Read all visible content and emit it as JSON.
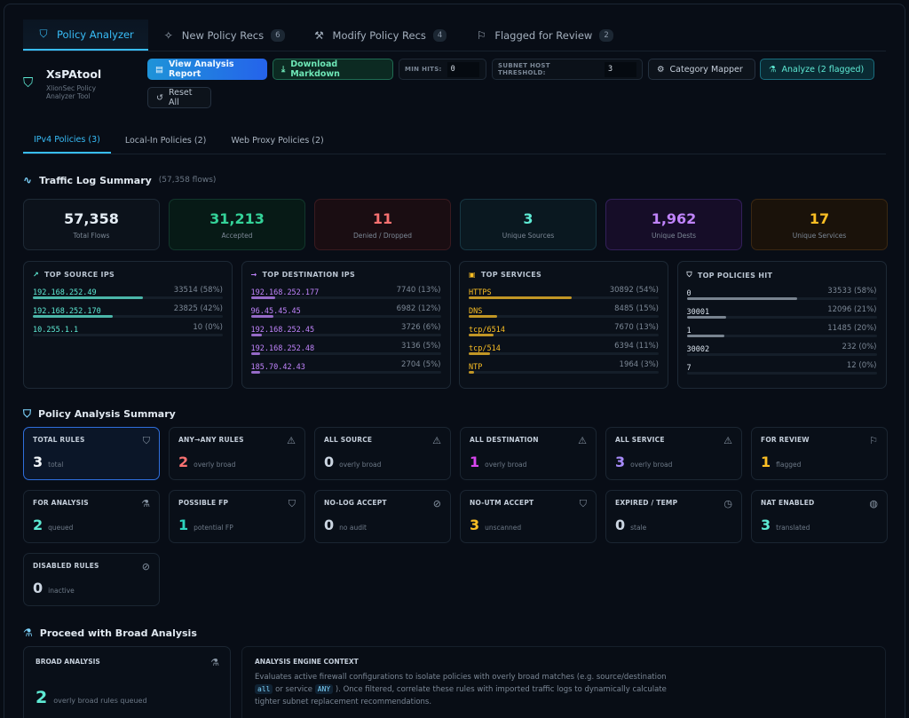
{
  "tabs": [
    {
      "label": "Policy Analyzer",
      "badge": ""
    },
    {
      "label": "New Policy Recs",
      "badge": "6"
    },
    {
      "label": "Modify Policy Recs",
      "badge": "4"
    },
    {
      "label": "Flagged for Review",
      "badge": "2"
    }
  ],
  "brand": {
    "title": "XsPAtool",
    "subtitle": "XlionSec Policy Analyzer Tool"
  },
  "toolbar": {
    "view_report": "View Analysis Report",
    "download_md": "Download Markdown",
    "min_hits_label": "MIN HITS:",
    "min_hits_value": "0",
    "subnet_label": "SUBNET HOST THRESHOLD:",
    "subnet_value": "3",
    "category_mapper": "Category Mapper",
    "analyze": "Analyze (2 flagged)",
    "reset": "Reset All"
  },
  "subtabs": [
    "IPv4 Policies (3)",
    "Local-In Policies (2)",
    "Web Proxy Policies (2)"
  ],
  "traffic": {
    "title": "Traffic Log Summary",
    "note": "(57,358 flows)",
    "metrics": [
      {
        "value": "57,358",
        "label": "Total Flows",
        "color": "#e5edf5"
      },
      {
        "value": "31,213",
        "label": "Accepted",
        "color": "#34d399"
      },
      {
        "value": "11",
        "label": "Denied / Dropped",
        "color": "#f87171"
      },
      {
        "value": "3",
        "label": "Unique Sources",
        "color": "#5eead4"
      },
      {
        "value": "1,962",
        "label": "Unique Dests",
        "color": "#c084fc"
      },
      {
        "value": "17",
        "label": "Unique Services",
        "color": "#fbbf24"
      }
    ]
  },
  "lists": [
    {
      "title": "TOP SOURCE IPS",
      "color": "#5eead4",
      "rows": [
        {
          "key": "192.168.252.49",
          "count": "33514 (58%)",
          "pct": 58
        },
        {
          "key": "192.168.252.170",
          "count": "23825 (42%)",
          "pct": 42
        },
        {
          "key": "10.255.1.1",
          "count": "10 (0%)",
          "pct": 0
        }
      ]
    },
    {
      "title": "TOP DESTINATION IPS",
      "color": "#c084fc",
      "rows": [
        {
          "key": "192.168.252.177",
          "count": "7740 (13%)",
          "pct": 13
        },
        {
          "key": "96.45.45.45",
          "count": "6982 (12%)",
          "pct": 12
        },
        {
          "key": "192.168.252.45",
          "count": "3726 (6%)",
          "pct": 6
        },
        {
          "key": "192.168.252.48",
          "count": "3136 (5%)",
          "pct": 5
        },
        {
          "key": "185.70.42.43",
          "count": "2704 (5%)",
          "pct": 5
        }
      ]
    },
    {
      "title": "TOP SERVICES",
      "color": "#fbbf24",
      "rows": [
        {
          "key": "HTTPS",
          "count": "30892 (54%)",
          "pct": 54
        },
        {
          "key": "DNS",
          "count": "8485 (15%)",
          "pct": 15
        },
        {
          "key": "tcp/6514",
          "count": "7670 (13%)",
          "pct": 13
        },
        {
          "key": "tcp/514",
          "count": "6394 (11%)",
          "pct": 11
        },
        {
          "key": "NTP",
          "count": "1964 (3%)",
          "pct": 3
        }
      ]
    },
    {
      "title": "TOP POLICIES HIT",
      "color": "#d9e2ec",
      "rows": [
        {
          "key": "0",
          "count": "33533 (58%)",
          "pct": 58
        },
        {
          "key": "30001",
          "count": "12096 (21%)",
          "pct": 21
        },
        {
          "key": "1",
          "count": "11485 (20%)",
          "pct": 20
        },
        {
          "key": "30002",
          "count": "232 (0%)",
          "pct": 0
        },
        {
          "key": "7",
          "count": "12 (0%)",
          "pct": 0
        }
      ]
    }
  ],
  "policy": {
    "title": "Policy Analysis Summary",
    "cards": [
      {
        "title": "TOTAL RULES",
        "value": "3",
        "sub": "total",
        "color": "#f1f5f9",
        "icon": "shield-icon"
      },
      {
        "title": "ANY→ANY RULES",
        "value": "2",
        "sub": "overly broad",
        "color": "#f87171",
        "icon": "warning-icon"
      },
      {
        "title": "ALL SOURCE",
        "value": "0",
        "sub": "overly broad",
        "color": "#cbd5e1",
        "icon": "warning-icon"
      },
      {
        "title": "ALL DESTINATION",
        "value": "1",
        "sub": "overly broad",
        "color": "#d946ef",
        "icon": "warning-icon"
      },
      {
        "title": "ALL SERVICE",
        "value": "3",
        "sub": "overly broad",
        "color": "#a78bfa",
        "icon": "warning-icon"
      },
      {
        "title": "FOR REVIEW",
        "value": "1",
        "sub": "flagged",
        "color": "#fbbf24",
        "icon": "flag-icon"
      },
      {
        "title": "FOR ANALYSIS",
        "value": "2",
        "sub": "queued",
        "color": "#5eead4",
        "icon": "microscope-icon"
      },
      {
        "title": "POSSIBLE FP",
        "value": "1",
        "sub": "potential FP",
        "color": "#2dd4bf",
        "icon": "shield-alert-icon"
      },
      {
        "title": "NO-LOG ACCEPT",
        "value": "0",
        "sub": "no audit",
        "color": "#cbd5e1",
        "icon": "eye-off-icon"
      },
      {
        "title": "NO-UTM ACCEPT",
        "value": "3",
        "sub": "unscanned",
        "color": "#fbbf24",
        "icon": "shield-alert-icon"
      },
      {
        "title": "EXPIRED / TEMP",
        "value": "0",
        "sub": "stale",
        "color": "#cbd5e1",
        "icon": "clock-icon"
      },
      {
        "title": "NAT ENABLED",
        "value": "3",
        "sub": "translated",
        "color": "#5eead4",
        "icon": "globe-icon"
      },
      {
        "title": "DISABLED RULES",
        "value": "0",
        "sub": "inactive",
        "color": "#cbd5e1",
        "icon": "eye-off-icon"
      }
    ]
  },
  "broad": {
    "title": "Proceed with Broad Analysis",
    "card_title": "BROAD ANALYSIS",
    "value": "2",
    "sub": "overly broad rules queued",
    "engine_title": "ANALYSIS ENGINE CONTEXT",
    "engine_text_1": "Evaluates active firewall configurations to isolate policies with overly broad matches (e.g. source/destination",
    "code_1": "all",
    "engine_text_2": "or service",
    "code_2": "ANY",
    "engine_text_3": "). Once filtered, correlate these rules with imported traffic logs to dynamically calculate tighter subnet replacement recommendations."
  }
}
